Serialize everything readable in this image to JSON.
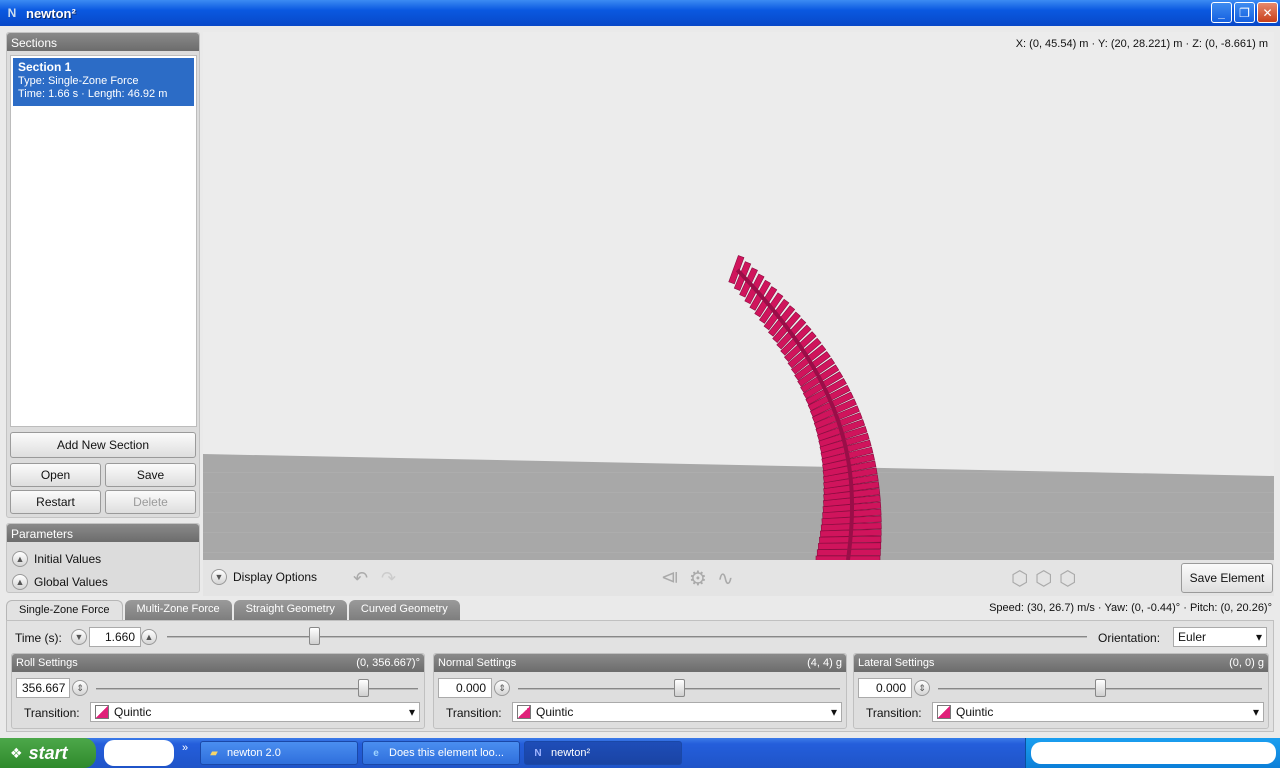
{
  "window": {
    "title": "newton²",
    "icon_letter": "N"
  },
  "sections_panel": {
    "title": "Sections",
    "items": [
      {
        "name": "Section 1",
        "type": "Type: Single-Zone Force",
        "details": "Time: 1.66 s · Length: 46.92 m"
      }
    ],
    "buttons": {
      "add": "Add New Section",
      "open": "Open",
      "save": "Save",
      "restart": "Restart",
      "delete": "Delete"
    }
  },
  "parameters_panel": {
    "title": "Parameters",
    "items": [
      "Initial Values",
      "Global Values"
    ]
  },
  "viewport": {
    "coords": "X: (0, 45.54) m  ·  Y: (20, 28.221) m  ·  Z: (0, -8.661) m",
    "track_color": "#d0145c",
    "ground_color": "#a8a8a8",
    "sky_color": "#ececec"
  },
  "toolbar": {
    "display_options": "Display Options",
    "save_element": "Save Element",
    "status": "Speed: (30, 26.7) m/s · Yaw: (0, -0.44)° · Pitch: (0, 20.26)°"
  },
  "tabs": [
    "Single-Zone Force",
    "Multi-Zone Force",
    "Straight Geometry",
    "Curved Geometry"
  ],
  "controls": {
    "time_label": "Time (s):",
    "time_value": "1.660",
    "time_fraction": 0.16,
    "orientation_label": "Orientation:",
    "orientation_value": "Euler",
    "roll": {
      "title": "Roll Settings",
      "range": "(0, 356.667)°",
      "value": "356.667",
      "fraction": 0.83,
      "transition_label": "Transition:",
      "transition": "Quintic"
    },
    "normal": {
      "title": "Normal Settings",
      "range": "(4, 4) g",
      "value": "0.000",
      "fraction": 0.5,
      "transition_label": "Transition:",
      "transition": "Quintic"
    },
    "lateral": {
      "title": "Lateral Settings",
      "range": "(0, 0) g",
      "value": "0.000",
      "fraction": 0.5,
      "transition_label": "Transition:",
      "transition": "Quintic"
    }
  },
  "taskbar": {
    "start": "start",
    "tasks": [
      {
        "label": "newton 2.0",
        "icon": "folder-icon"
      },
      {
        "label": "Does this element loo...",
        "icon": "ie-icon"
      },
      {
        "label": "newton²",
        "icon": "newton-icon"
      }
    ]
  }
}
